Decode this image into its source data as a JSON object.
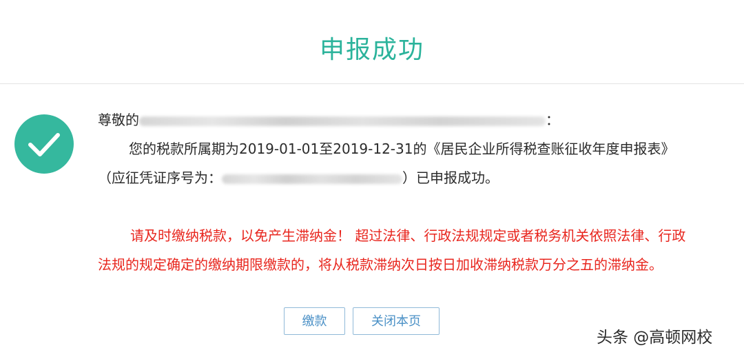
{
  "header": {
    "title": "申报成功"
  },
  "message": {
    "greeting_prefix": "尊敬的",
    "greeting_suffix": "：",
    "period_text": "您的税款所属期为2019-01-01至2019-12-31的《居民企业所得税查账征收年度申报表》",
    "cert_prefix": "（应征凭证序号为：",
    "cert_suffix": "）已申报成功。"
  },
  "warning": {
    "line1": "请及时缴纳税款，以免产生滞纳金！ 超过法律、行政法规规定或者税务机关依照法律、行政",
    "line2": "法规的规定确定的缴纳期限缴款的，将从税款滞纳次日按日加收滞纳税款万分之五的滞纳金。"
  },
  "buttons": {
    "pay": "缴款",
    "close": "关闭本页"
  },
  "watermark": {
    "text": "头条 @高顿网校"
  },
  "colors": {
    "title": "#2bb39b",
    "success_icon": "#35b89e",
    "warning_text": "#e8261e",
    "button_border": "#8fb9d8",
    "button_text": "#4a90c6"
  },
  "icons": {
    "success": "check-circle-icon"
  }
}
